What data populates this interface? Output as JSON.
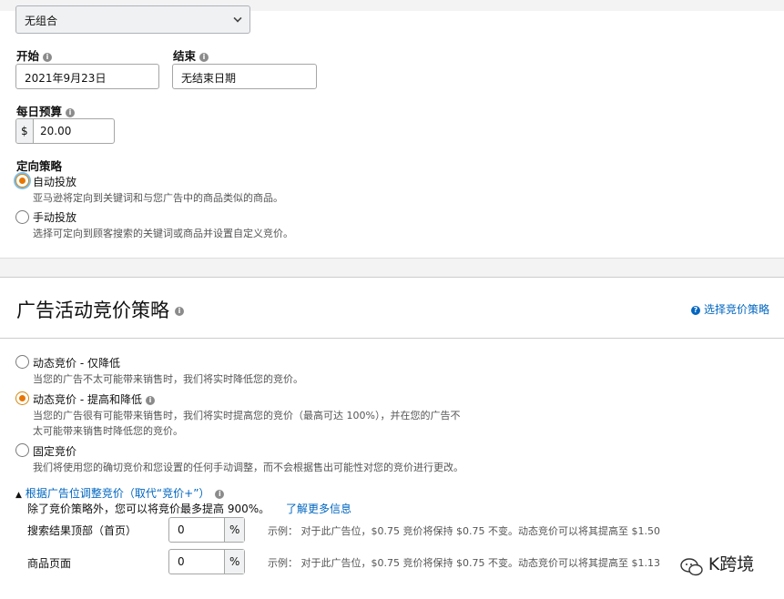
{
  "combo": {
    "value": "无组合"
  },
  "start": {
    "label": "开始",
    "value": "2021年9月23日"
  },
  "end": {
    "label": "结束",
    "placeholder": "无结束日期"
  },
  "budget": {
    "label": "每日预算",
    "currency": "$",
    "value": "20.00"
  },
  "targeting": {
    "label": "定向策略",
    "options": [
      {
        "label": "自动投放",
        "desc": "亚马逊将定向到关键词和与您广告中的商品类似的商品。",
        "selected": true
      },
      {
        "label": "手动投放",
        "desc": "选择可定向到顾客搜索的关键词或商品并设置自定义竞价。",
        "selected": false
      }
    ]
  },
  "bidding": {
    "title": "广告活动竞价策略",
    "help_link": "选择竞价策略",
    "options": [
      {
        "label": "动态竞价 - 仅降低",
        "desc": [
          "当您的广告不太可能带来销售时，我们将实时降低您的竞价。"
        ],
        "selected": false
      },
      {
        "label": "动态竞价 - 提高和降低",
        "desc": [
          "当您的广告很有可能带来销售时，我们将实时提高您的竞价（最高可达 100%），并在您的广告不",
          "太可能带来销售时降低您的竞价。"
        ],
        "selected": true
      },
      {
        "label": "固定竞价",
        "desc": [
          "我们将使用您的确切竞价和您设置的任何手动调整，而不会根据售出可能性对您的竞价进行更改。"
        ],
        "selected": false
      }
    ]
  },
  "placement": {
    "toggle_label": "根据广告位调整竞价（取代“竞价+”）",
    "note": "除了竞价策略外，您可以将竞价最多提高 900%。",
    "learn_more": "了解更多信息",
    "rows": [
      {
        "label": "搜索结果顶部（首页）",
        "value": "0",
        "unit": "%",
        "example": "示例： 对于此广告位，$0.75 竞价将保持 $0.75 不变。动态竞价可以将其提高至 $1.50"
      },
      {
        "label": "商品页面",
        "value": "0",
        "unit": "%",
        "example": "示例： 对于此广告位，$0.75 竞价将保持 $0.75 不变。动态竞价可以将其提高至 $1.13"
      }
    ]
  },
  "watermark": {
    "text": "K跨境"
  }
}
